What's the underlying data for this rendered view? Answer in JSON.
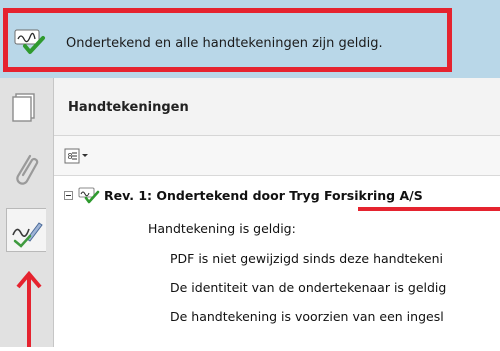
{
  "signature_bar": {
    "icon": "signature-valid-icon",
    "message": "Ondertekend en alle handtekeningen zijn geldig."
  },
  "left_rail": {
    "items": [
      {
        "icon": "pages-icon"
      },
      {
        "icon": "attachment-paperclip-icon"
      },
      {
        "icon": "signatures-pen-icon",
        "active": true
      }
    ]
  },
  "panel": {
    "title": "Handtekeningen",
    "options_icon": "options-menu-icon",
    "tree": {
      "revision": "Rev. 1: Ondertekend door Tryg Forsikring A/S",
      "status": "Handtekening is geldig:",
      "details": [
        "PDF is niet gewijzigd sinds deze handtekeni",
        "De identiteit van de ondertekenaar is geldig",
        "De handtekening is voorzien van een ingesl"
      ]
    }
  },
  "annotation_color": "#e5232f"
}
